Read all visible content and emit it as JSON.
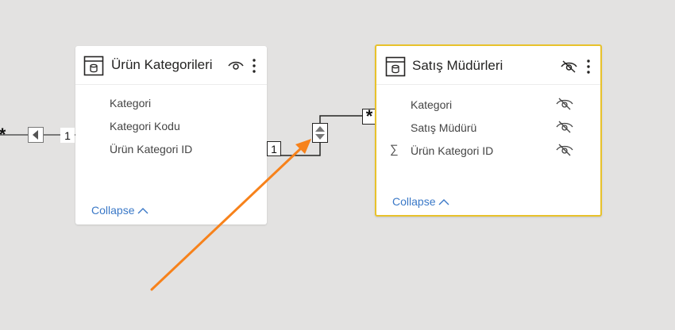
{
  "tables": [
    {
      "title": "Ürün Kategorileri",
      "fields": [
        "Kategori",
        "Kategori Kodu",
        "Ürün Kategori ID"
      ],
      "collapse_label": "Collapse"
    },
    {
      "title": "Satış Müdürleri",
      "fields": [
        "Kategori",
        "Satış Müdürü",
        "Ürün Kategori ID"
      ],
      "collapse_label": "Collapse"
    }
  ],
  "relationships": {
    "left_many": "*",
    "left_one": "1",
    "middle_one": "1",
    "right_many": "*"
  },
  "icons": {
    "table": "table-icon",
    "visible": "eye-icon",
    "hidden": "eye-off-icon",
    "more": "more-vertical-icon",
    "sum": "sigma-icon",
    "collapse": "chevron-up-icon",
    "cross_filter": "both-direction-arrow-icon"
  },
  "colors": {
    "canvas": "#e3e2e1",
    "selected_border": "#e8c22b",
    "link": "#3a78c7",
    "annotation_arrow": "#f7821b"
  }
}
